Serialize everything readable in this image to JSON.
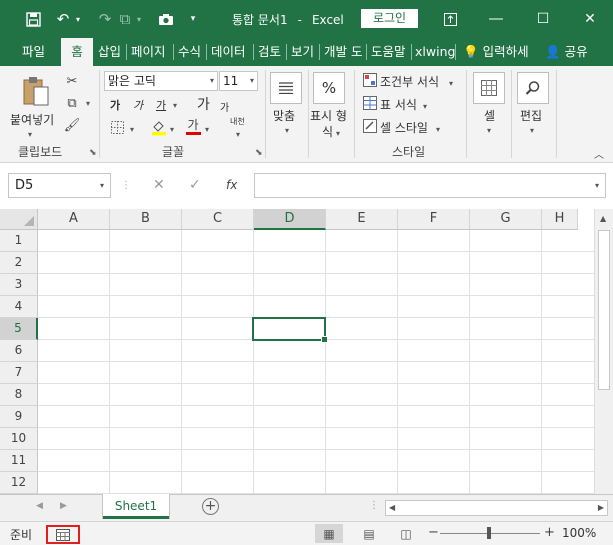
{
  "titlebar": {
    "title": "통합 문서1",
    "app": "Excel",
    "login_label": "로그인",
    "icons": [
      "save-icon",
      "undo-icon",
      "redo-icon",
      "camera-icon",
      "customize-qat-icon",
      "ribbon-display-icon",
      "minimize-icon",
      "maximize-icon",
      "close-icon"
    ]
  },
  "tabs": [
    {
      "label": "파일"
    },
    {
      "label": "홈",
      "active": true
    },
    {
      "label": "삽입"
    },
    {
      "label": "페이지"
    },
    {
      "label": "수식"
    },
    {
      "label": "데이터"
    },
    {
      "label": "검토"
    },
    {
      "label": "보기"
    },
    {
      "label": "개발 도"
    },
    {
      "label": "도움말"
    },
    {
      "label": "xlwing"
    }
  ],
  "tell_me": "입력하세",
  "share": "공유",
  "ribbon": {
    "clipboard": {
      "label": "클립보드",
      "paste": "붙여넣기"
    },
    "font": {
      "label": "글꼴",
      "name": "맑은 고딕",
      "size": "11",
      "bold": "가",
      "italic": "가",
      "underline": "가",
      "grow": "가",
      "shrink": "가",
      "font_color": "가",
      "phonetic": "내천"
    },
    "alignment": {
      "label": "맞춤"
    },
    "number": {
      "label_line1": "표시 형",
      "label_line2": "식",
      "icon": "%"
    },
    "styles": {
      "label": "스타일",
      "conditional": "조건부 서식",
      "table": "표 서식",
      "cell_styles": "셀 스타일"
    },
    "cells": {
      "label": "셀"
    },
    "editing": {
      "label": "편집"
    }
  },
  "formula_bar": {
    "name_box": "D5",
    "cancel": "✕",
    "enter": "✓",
    "fx": "fx",
    "content": ""
  },
  "grid": {
    "columns": [
      "A",
      "B",
      "C",
      "D",
      "E",
      "F",
      "G",
      "H"
    ],
    "rows": [
      "1",
      "2",
      "3",
      "4",
      "5",
      "6",
      "7",
      "8",
      "9",
      "10",
      "11",
      "12"
    ],
    "selected_cell": "D5"
  },
  "sheets": [
    {
      "name": "Sheet1",
      "active": true
    }
  ],
  "status": {
    "ready": "준비",
    "zoom": "100%"
  }
}
